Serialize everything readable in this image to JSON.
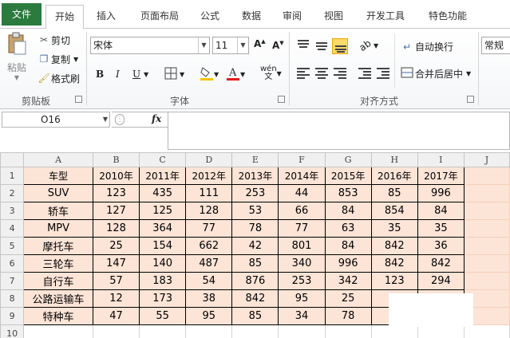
{
  "tabs": [
    "文件",
    "开始",
    "插入",
    "页面布局",
    "公式",
    "数据",
    "审阅",
    "视图",
    "开发工具",
    "特色功能"
  ],
  "clipboard": {
    "paste_label": "粘贴",
    "cut_label": "剪切",
    "copy_label": "复制",
    "format_painter_label": "格式刷",
    "group_label": "剪贴板"
  },
  "font": {
    "font_name": "宋体",
    "font_size": "11",
    "bold_label": "B",
    "italic_label": "I",
    "underline_label": "U",
    "group_label": "字体"
  },
  "alignment": {
    "wrap_label": "自动换行",
    "merge_label": "合并后居中",
    "group_label": "对齐方式"
  },
  "number": {
    "format_value": "常规"
  },
  "formula_bar": {
    "name_box": "O16",
    "fx_label": "fx",
    "formula": ""
  },
  "sheet": {
    "columns": [
      "A",
      "B",
      "C",
      "D",
      "E",
      "F",
      "G",
      "H",
      "I",
      "J"
    ],
    "header_row": [
      "车型",
      "2010年",
      "2011年",
      "2012年",
      "2013年",
      "2014年",
      "2015年",
      "2016年",
      "2017年"
    ],
    "rows": [
      [
        "SUV",
        "123",
        "435",
        "111",
        "253",
        "44",
        "853",
        "85",
        "996"
      ],
      [
        "轿车",
        "127",
        "125",
        "128",
        "53",
        "66",
        "84",
        "854",
        "84"
      ],
      [
        "MPV",
        "128",
        "364",
        "77",
        "78",
        "77",
        "63",
        "35",
        "35"
      ],
      [
        "摩托车",
        "25",
        "154",
        "662",
        "42",
        "801",
        "84",
        "842",
        "36"
      ],
      [
        "三轮车",
        "147",
        "140",
        "487",
        "85",
        "340",
        "996",
        "842",
        "842"
      ],
      [
        "自行车",
        "57",
        "183",
        "54",
        "876",
        "253",
        "342",
        "123",
        "294"
      ],
      [
        "公路运输车",
        "12",
        "173",
        "38",
        "842",
        "95",
        "25",
        "",
        ""
      ],
      [
        "特种车",
        "47",
        "55",
        "95",
        "85",
        "34",
        "78",
        "",
        ""
      ]
    ],
    "row_numbers": [
      "1",
      "2",
      "3",
      "4",
      "5",
      "6",
      "7",
      "8",
      "9",
      "10"
    ]
  }
}
